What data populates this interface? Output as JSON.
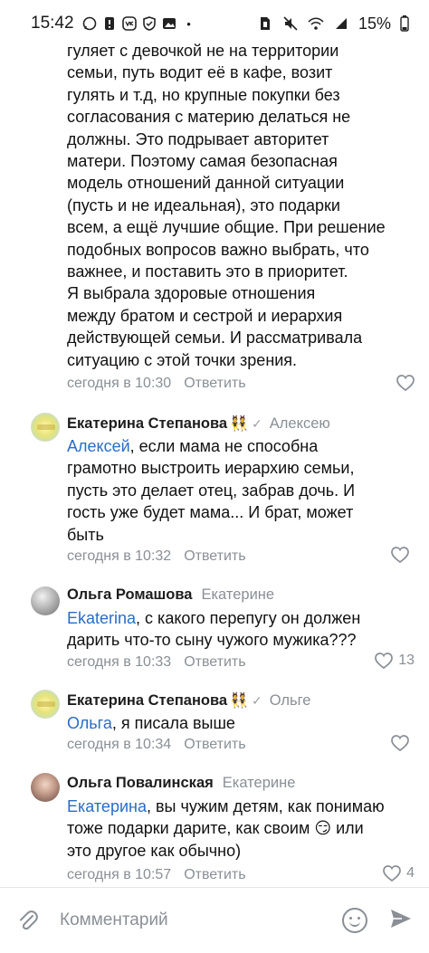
{
  "status_bar": {
    "time": "15:42",
    "battery": "15%",
    "left_icons": [
      "whatsapp-icon",
      "notification-icon",
      "vk-icon",
      "shield-icon",
      "gallery-icon",
      "dot-icon"
    ],
    "right_icons": [
      "sim-icon",
      "mute-icon",
      "wifi-icon",
      "signal-icon",
      "battery-icon"
    ]
  },
  "first_comment": {
    "lines": [
      "гуляет с девочкой не на территории",
      "семьи, путь водит её в кафе, возит",
      "гулять и т.д, но крупные покупки без",
      "согласования с материю делаться не",
      "должны. Это подрывает авторитет",
      "матери. Поэтому самая безопасная",
      "модель отношений данной ситуации",
      "(пусть и не идеальная), это подарки",
      "всем, а ещё лучшие общие. При решение",
      "подобных вопросов важно выбрать, что",
      "важнее, и поставить это в приоритет.",
      "Я выбрала здоровые отношения",
      "между братом и сестрой и иерархия",
      "действующей семьи. И рассматривала",
      "ситуацию с этой точки зрения."
    ],
    "time": "сегодня в 10:30",
    "reply": "Ответить"
  },
  "comments": [
    {
      "author": "Екатерина Степанова",
      "badge": "👯",
      "verified": "✓",
      "to": "Алексею",
      "mention": "Алексей",
      "text_lines": [
        ", если мама не способна",
        "грамотно выстроить иерархию семьи,",
        "пусть это делает отец, забрав дочь. И",
        "гость уже будет мама... И брат, может",
        "быть"
      ],
      "time": "сегодня в 10:32",
      "reply": "Ответить",
      "likes": ""
    },
    {
      "author": "Ольга Ромашова",
      "to": "Екатерине",
      "mention": "Ekaterina",
      "text_lines": [
        ", с какого перепугу он должен",
        "дарить что-то сыну чужого мужика???"
      ],
      "time": "сегодня в 10:33",
      "reply": "Ответить",
      "likes": "13"
    },
    {
      "author": "Екатерина Степанова",
      "badge": "👯",
      "verified": "✓",
      "to": "Ольге",
      "mention": "Ольга",
      "text_lines": [
        ", я писала выше"
      ],
      "time": "сегодня в 10:34",
      "reply": "Ответить",
      "likes": ""
    },
    {
      "author": "Ольга Повалинская",
      "to": "Екатерине",
      "mention": "Екатерина",
      "text_lines": [
        ", вы чужим детям, как понимаю",
        "тоже подарки дарите, как своим 😏 или",
        "это другое как обычно)"
      ],
      "time": "сегодня в 10:57",
      "reply": "Ответить",
      "likes": "4"
    }
  ],
  "composer": {
    "placeholder": "Комментарий",
    "attach_icon": "paperclip-icon",
    "emoji_icon": "smile-icon",
    "send_icon": "send-icon"
  },
  "colors": {
    "mention": "#2a6cc7",
    "meta": "#8a8f96",
    "badge": "#e04bb7"
  }
}
